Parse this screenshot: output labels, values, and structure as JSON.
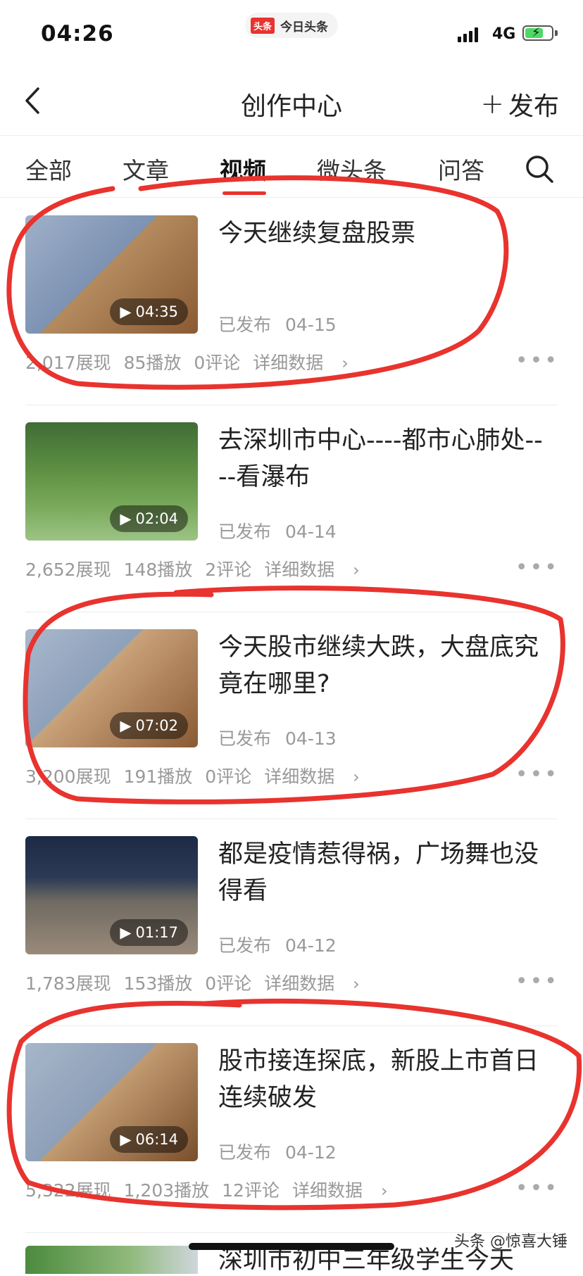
{
  "status_bar": {
    "time": "04:26",
    "app_logo": "头条",
    "app_name": "今日头条",
    "network": "4G"
  },
  "nav": {
    "back_icon": "chevron-left-icon",
    "title": "创作中心",
    "publish_label": "发布"
  },
  "tabs": [
    {
      "label": "全部"
    },
    {
      "label": "文章"
    },
    {
      "label": "视频",
      "active": true
    },
    {
      "label": "微头条"
    },
    {
      "label": "问答"
    }
  ],
  "videos": [
    {
      "title": "今天继续复盘股票",
      "duration": "04:35",
      "status": "已发布",
      "date": "04-15",
      "impressions": "2,017展现",
      "plays": "85播放",
      "comments": "0评论",
      "detail": "详细数据"
    },
    {
      "title": "去深圳市中心----都市心肺处----看瀑布",
      "duration": "02:04",
      "status": "已发布",
      "date": "04-14",
      "impressions": "2,652展现",
      "plays": "148播放",
      "comments": "2评论",
      "detail": "详细数据"
    },
    {
      "title": "今天股市继续大跌，大盘底究竟在哪里?",
      "duration": "07:02",
      "status": "已发布",
      "date": "04-13",
      "impressions": "3,200展现",
      "plays": "191播放",
      "comments": "0评论",
      "detail": "详细数据"
    },
    {
      "title": "都是疫情惹得祸，广场舞也没得看",
      "duration": "01:17",
      "status": "已发布",
      "date": "04-12",
      "impressions": "1,783展现",
      "plays": "153播放",
      "comments": "0评论",
      "detail": "详细数据"
    },
    {
      "title": "股市接连探底，新股上市首日连续破发",
      "duration": "06:14",
      "status": "已发布",
      "date": "04-12",
      "impressions": "5,322展现",
      "plays": "1,203播放",
      "comments": "12评论",
      "detail": "详细数据"
    }
  ],
  "partial_next_title": "深圳市初中三年级学生今天",
  "watermark": "头条 @惊喜大锤",
  "colors": {
    "accent": "#e8332e",
    "annotation": "#e8332e",
    "muted_text": "#999999"
  }
}
